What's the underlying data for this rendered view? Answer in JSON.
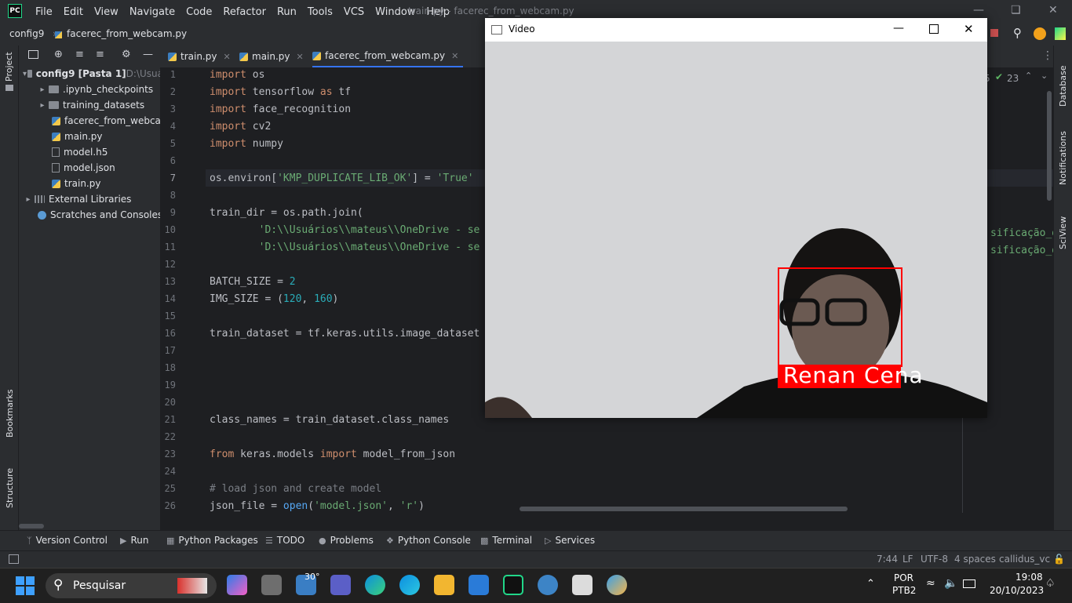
{
  "titlebar": {
    "logo": "PC",
    "menu": [
      "File",
      "Edit",
      "View",
      "Navigate",
      "Code",
      "Refactor",
      "Run",
      "Tools",
      "VCS",
      "Window",
      "Help"
    ],
    "window_title": "train.py - facerec_from_webcam.py"
  },
  "navbar": {
    "project": "config9",
    "file": "facerec_from_webcam.py"
  },
  "left_strip": {
    "project_label": "Project",
    "bookmarks_label": "Bookmarks",
    "structure_label": "Structure"
  },
  "right_strip": {
    "database_label": "Database",
    "notifications_label": "Notifications",
    "sciview_label": "SciView"
  },
  "project_tree": [
    {
      "label": "config9 [Pasta 1]",
      "suffix": "D:\\Usuá",
      "type": "folder",
      "level": 0,
      "expanded": true
    },
    {
      "label": ".ipynb_checkpoints",
      "type": "folder",
      "level": 1
    },
    {
      "label": "training_datasets",
      "type": "folder",
      "level": 1
    },
    {
      "label": "facerec_from_webcam",
      "type": "py",
      "level": 1
    },
    {
      "label": "main.py",
      "type": "py",
      "level": 1
    },
    {
      "label": "model.h5",
      "type": "file",
      "level": 1
    },
    {
      "label": "model.json",
      "type": "file",
      "level": 1
    },
    {
      "label": "train.py",
      "type": "py",
      "level": 1
    },
    {
      "label": "External Libraries",
      "type": "lib",
      "level": 0
    },
    {
      "label": "Scratches and Consoles",
      "type": "scratch",
      "level": 0
    }
  ],
  "tabs": [
    {
      "label": "train.py",
      "active": false
    },
    {
      "label": "main.py",
      "active": false
    },
    {
      "label": "facerec_from_webcam.py",
      "active": true
    }
  ],
  "inspections": {
    "warnings": "5",
    "ok_count": "23"
  },
  "code_lines": [
    {
      "n": "1",
      "html": "<span class='kw'>import</span> os"
    },
    {
      "n": "2",
      "html": "<span class='kw'>import</span> tensorflow <span class='kw'>as</span> tf"
    },
    {
      "n": "3",
      "html": "<span class='kw'>import</span> face_recognition"
    },
    {
      "n": "4",
      "html": "<span class='kw'>import</span> cv2"
    },
    {
      "n": "5",
      "html": "<span class='kw'>import</span> numpy"
    },
    {
      "n": "6",
      "html": ""
    },
    {
      "n": "7",
      "html": "os.environ[<span class='str'>'KMP_DUPLICATE_LIB_OK'</span>] = <span class='str'>'True'</span>"
    },
    {
      "n": "8",
      "html": ""
    },
    {
      "n": "9",
      "html": "train_dir = os.path.join("
    },
    {
      "n": "10",
      "html": "        <span class='str'>'D:\\\\Usuários\\\\mateus\\\\OneDrive - se</span>"
    },
    {
      "n": "11",
      "html": "        <span class='str'>'D:\\\\Usuários\\\\mateus\\\\OneDrive - se</span>"
    },
    {
      "n": "12",
      "html": ""
    },
    {
      "n": "13",
      "html": "BATCH_SIZE = <span class='num'>2</span>"
    },
    {
      "n": "14",
      "html": "IMG_SIZE = (<span class='num'>120</span>, <span class='num'>160</span>)"
    },
    {
      "n": "15",
      "html": ""
    },
    {
      "n": "16",
      "html": "train_dataset = tf.keras.utils.image_dataset"
    },
    {
      "n": "17",
      "html": ""
    },
    {
      "n": "18",
      "html": ""
    },
    {
      "n": "19",
      "html": ""
    },
    {
      "n": "20",
      "html": ""
    },
    {
      "n": "21",
      "html": "class_names = train_dataset.class_names"
    },
    {
      "n": "22",
      "html": ""
    },
    {
      "n": "23",
      "html": "<span class='kw'>from</span> keras.models <span class='kw'>import</span> model_from_json"
    },
    {
      "n": "24",
      "html": ""
    },
    {
      "n": "25",
      "html": "<span class='cm'># load json and create model</span>"
    },
    {
      "n": "26",
      "html": "json_file = <span class='fn'>open</span>(<span class='str'>'model.json'</span>, <span class='str'>'r'</span>)"
    }
  ],
  "code_right_fragment": "sificação_d",
  "toolwindows": [
    "Version Control",
    "Run",
    "Python Packages",
    "TODO",
    "Problems",
    "Python Console",
    "Terminal",
    "Services"
  ],
  "statusbar": {
    "position": "7:44",
    "line_sep": "LF",
    "encoding": "UTF-8",
    "indent": "4 spaces",
    "interpreter": "callidus_vc"
  },
  "video_window": {
    "title": "Video",
    "face_label": "Renan Cena"
  },
  "taskbar": {
    "search_placeholder": "Pesquisar",
    "weather": "30°",
    "lang1": "POR",
    "lang2": "PTB2",
    "time": "19:08",
    "date": "20/10/2023"
  },
  "colors": {
    "accent": "#3574f0",
    "ide_bg": "#1e1f22",
    "panel_bg": "#2b2d30",
    "face_box": "#ff0000"
  }
}
